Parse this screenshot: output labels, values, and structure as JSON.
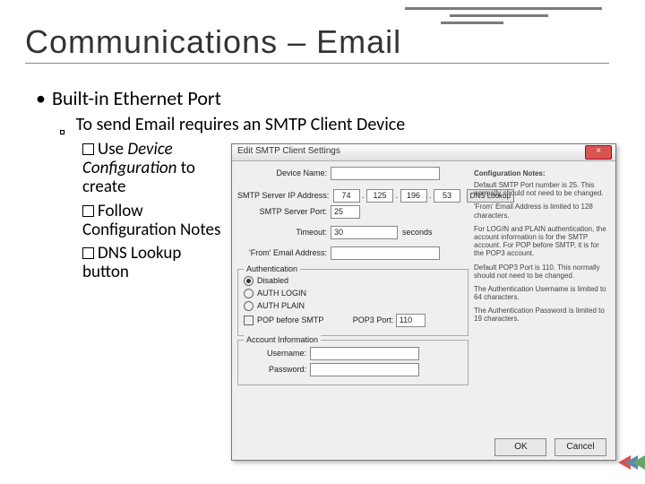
{
  "slide": {
    "title": "Communications – Email",
    "bullet1": "Built-in Ethernet Port",
    "bullet2": "To send Email requires an SMTP Client Device",
    "sub1_a": "Use ",
    "sub1_b": "Device Configuration",
    "sub1_c": " to create",
    "sub2": "Follow Configuration Notes",
    "sub3": "DNS Lookup button"
  },
  "dlg": {
    "title": "Edit SMTP Client Settings",
    "close": "×",
    "device_name_lbl": "Device Name:",
    "ip_lbl": "SMTP Server IP Address:",
    "ip_a": "74",
    "ip_b": "125",
    "ip_c": "196",
    "ip_d": "53",
    "dns_btn": "DNS Lookup",
    "port_lbl": "SMTP Server Port:",
    "port_val": "25",
    "timeout_lbl": "Timeout:",
    "timeout_val": "30",
    "timeout_units": "seconds",
    "from_lbl": "'From' Email Address:",
    "auth_legend": "Authentication",
    "opt_disabled": "Disabled",
    "opt_login": "AUTH LOGIN",
    "opt_plain": "AUTH PLAIN",
    "opt_pop": "POP before SMTP",
    "pop3_lbl": "POP3 Port:",
    "pop3_val": "110",
    "acct_legend": "Account Information",
    "user_lbl": "Username:",
    "pass_lbl": "Password:",
    "ok": "OK",
    "cancel": "Cancel"
  },
  "notes": {
    "hdr": "Configuration Notes:",
    "n1": "Default SMTP Port number is 25. This normally should not need to be changed.",
    "n2": "'From' Email Address is limited to 128 characters.",
    "n3": "For LOGIN and PLAIN authentication, the account information is for the SMTP account. For POP before SMTP, it is for the POP3 account.",
    "n4": "Default POP3 Port is 110. This normally should not need to be changed.",
    "n5": "The Authentication Username is limited to 64 characters.",
    "n6": "The Authentication Password is limited to 19 characters."
  }
}
